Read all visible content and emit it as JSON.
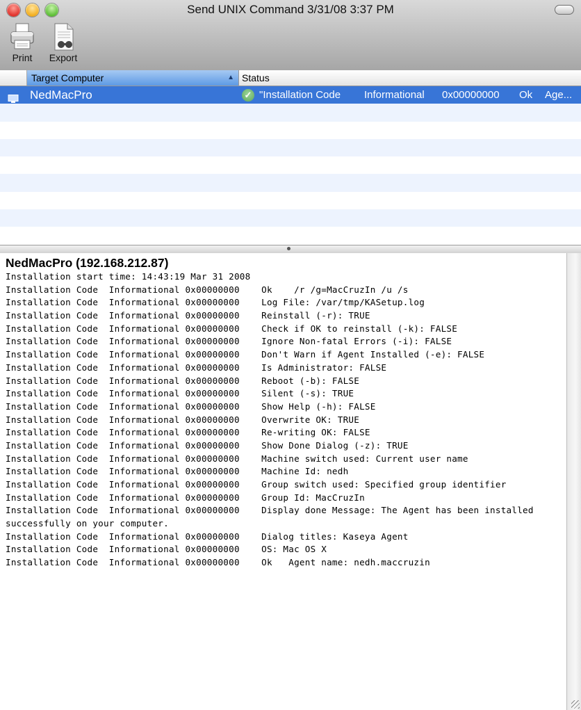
{
  "window": {
    "title": "Send UNIX Command  3/31/08 3:37 PM"
  },
  "toolbar": {
    "print_label": "Print",
    "export_label": "Export"
  },
  "table": {
    "columns": {
      "target": "Target Computer",
      "status": "Status"
    },
    "selected_row": {
      "computer": "NedMacPro",
      "code": "\"Installation Code",
      "type": "Informational",
      "hex": "0x00000000",
      "result": "Ok",
      "extra": "Age..."
    }
  },
  "log": {
    "title": "NedMacPro (192.168.212.87)",
    "lines": [
      "Installation start time: 14:43:19 Mar 31 2008",
      "Installation Code  Informational 0x00000000    Ok    /r /g=MacCruzIn /u /s",
      "Installation Code  Informational 0x00000000    Log File: /var/tmp/KASetup.log",
      "Installation Code  Informational 0x00000000    Reinstall (-r): TRUE",
      "Installation Code  Informational 0x00000000    Check if OK to reinstall (-k): FALSE",
      "Installation Code  Informational 0x00000000    Ignore Non-fatal Errors (-i): FALSE",
      "Installation Code  Informational 0x00000000    Don't Warn if Agent Installed (-e): FALSE",
      "Installation Code  Informational 0x00000000    Is Administrator: FALSE",
      "Installation Code  Informational 0x00000000    Reboot (-b): FALSE",
      "Installation Code  Informational 0x00000000    Silent (-s): TRUE",
      "Installation Code  Informational 0x00000000    Show Help (-h): FALSE",
      "Installation Code  Informational 0x00000000    Overwrite OK: TRUE",
      "Installation Code  Informational 0x00000000    Re-writing OK: FALSE",
      "Installation Code  Informational 0x00000000    Show Done Dialog (-z): TRUE",
      "Installation Code  Informational 0x00000000    Machine switch used: Current user name",
      "Installation Code  Informational 0x00000000    Machine Id: nedh",
      "Installation Code  Informational 0x00000000    Group switch used: Specified group identifier",
      "Installation Code  Informational 0x00000000    Group Id: MacCruzIn",
      "Installation Code  Informational 0x00000000    Display done Message: The Agent has been installed",
      "successfully on your computer.",
      "Installation Code  Informational 0x00000000    Dialog titles: Kaseya Agent",
      "Installation Code  Informational 0x00000000    OS: Mac OS X",
      "Installation Code  Informational 0x00000000    Ok   Agent name: nedh.maccruzin"
    ]
  }
}
